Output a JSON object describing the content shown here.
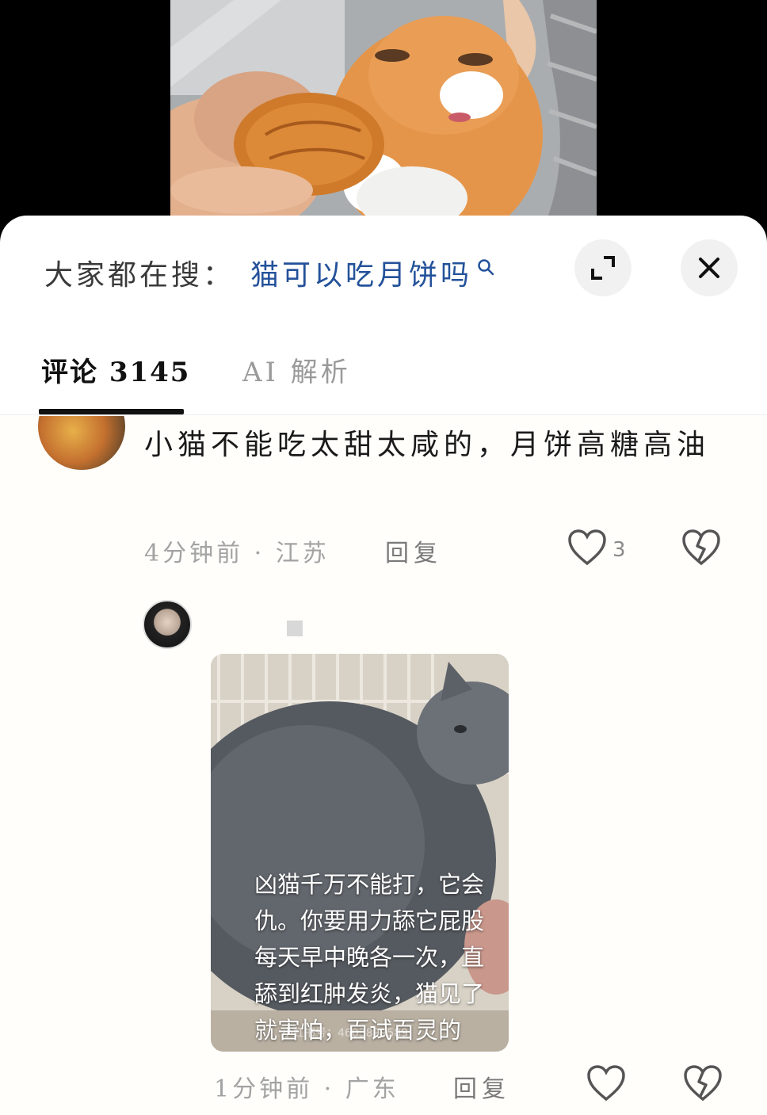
{
  "search": {
    "prefix": "大家都在搜：",
    "term": "猫可以吃月饼吗"
  },
  "controls": {
    "expand_icon": "expand-icon",
    "close_icon": "close-icon"
  },
  "tabs": [
    {
      "label": "评论 3145",
      "active": true
    },
    {
      "label": "AI 解析",
      "active": false
    }
  ],
  "comments": [
    {
      "text": "小猫不能吃太甜太咸的，月饼高糖高油",
      "time": "4分钟前",
      "location": "江苏",
      "meta": "4分钟前 · 江苏",
      "reply_label": "回复",
      "likes": "3"
    },
    {
      "image_text": "凶猫千万不能打，它会\n仇。你要用力舔它屁股\n每天早中晚各一次，直\n舔到红肿发炎，猫见了\n就害怕，百试百灵的",
      "watermark": "小红书号：4603899589",
      "time": "1分钟前",
      "location": "广东",
      "meta": "1分钟前 · 广东",
      "reply_label": "回复"
    }
  ],
  "colors": {
    "accent": "#24529a",
    "text": "#1a1a1a",
    "muted": "#a3a3a3"
  }
}
